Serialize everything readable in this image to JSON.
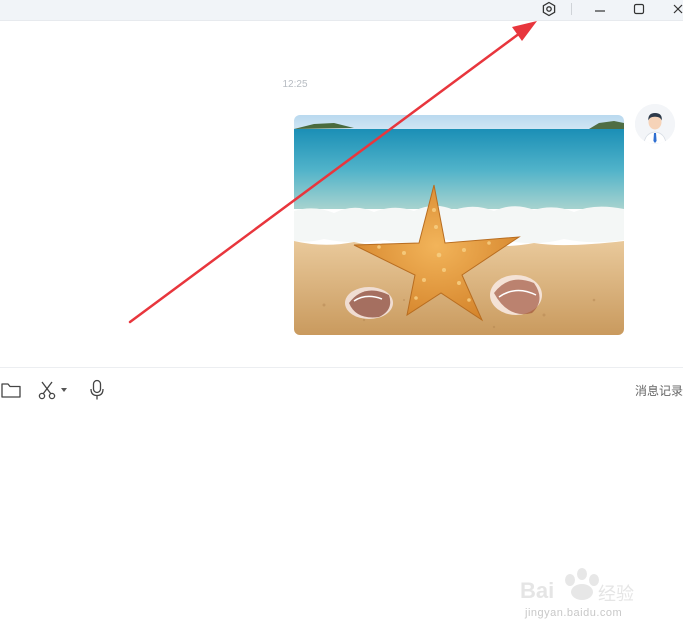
{
  "chat": {
    "timestamp": "12:25"
  },
  "toolbar": {
    "history_label": "消息记录"
  },
  "watermark": {
    "text": "jingyan.baidu.com",
    "brand": "Bai 经验"
  },
  "colors": {
    "arrow": "#e8363d",
    "titlebar_bg": "#f1f4f8",
    "timestamp": "#b7bcc2"
  },
  "icons": {
    "titlebar": [
      "settings-icon",
      "minimize-icon",
      "maximize-icon",
      "close-icon"
    ],
    "toolbar": [
      "folder-icon",
      "scissors-icon",
      "dropdown-caret-icon",
      "microphone-icon"
    ]
  }
}
